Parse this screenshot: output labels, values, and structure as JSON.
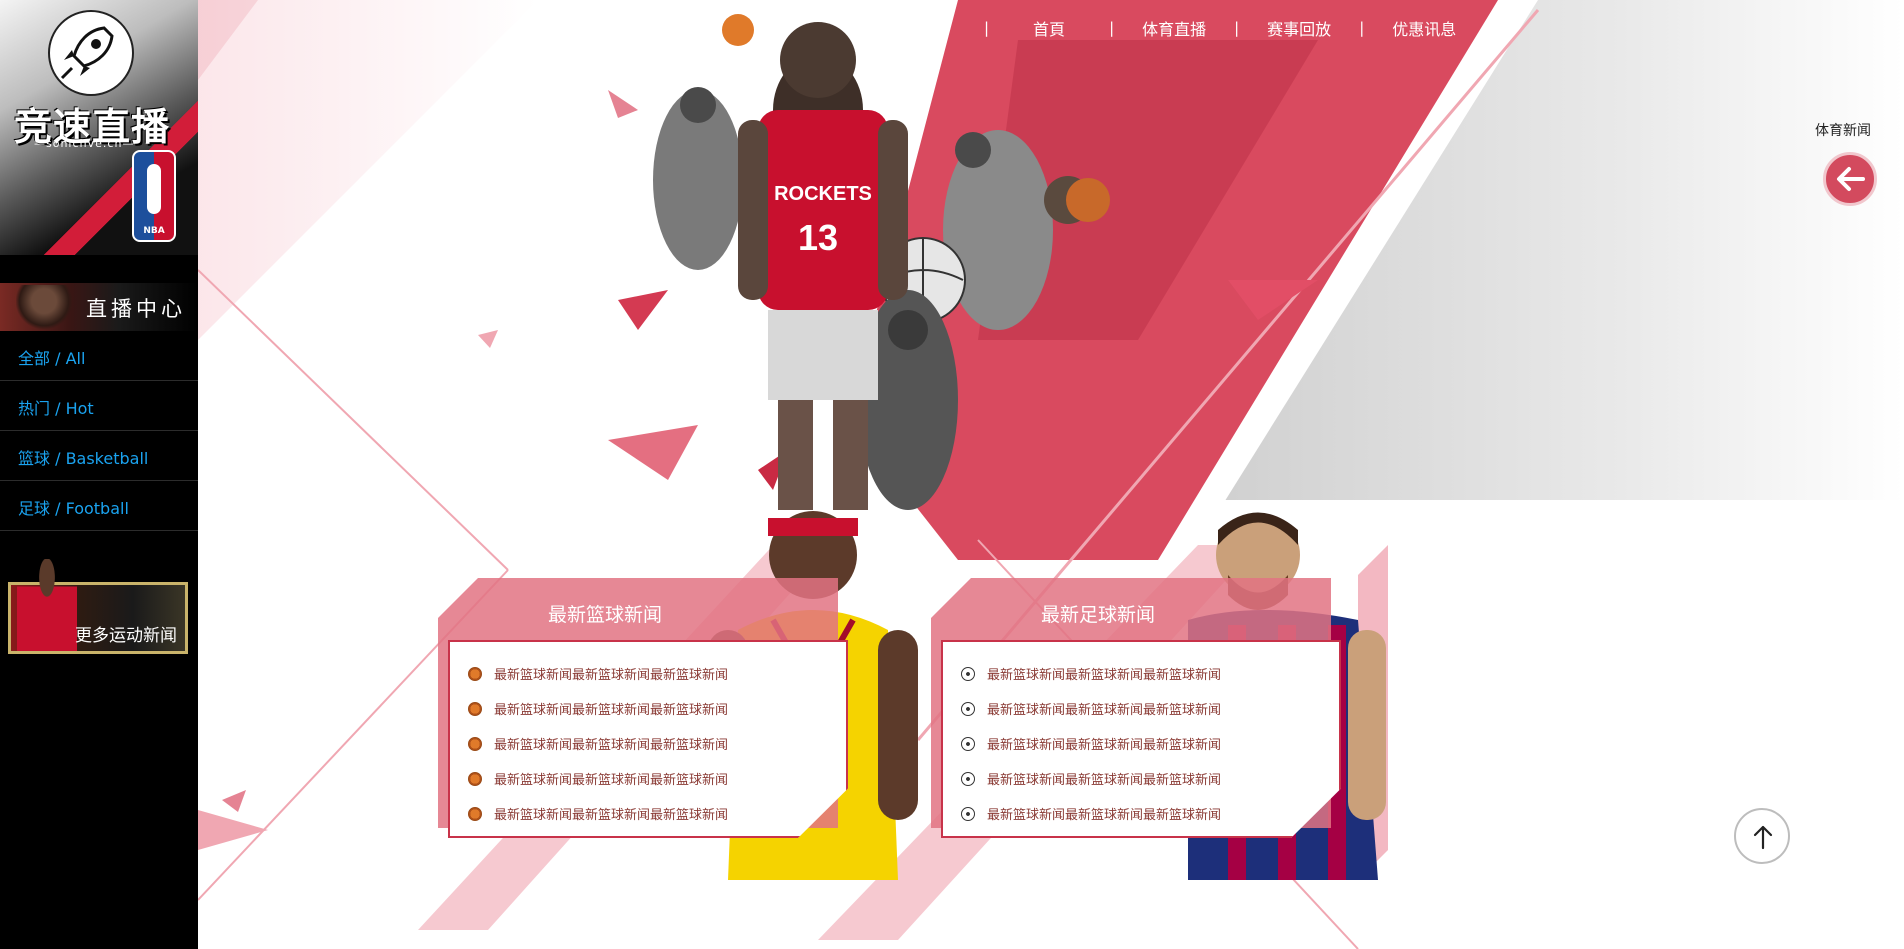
{
  "brand": {
    "name": "竞速直播",
    "domain": "soniclive.cn",
    "league_badge": "NBA"
  },
  "sidebar": {
    "live_center_label": "直播中心",
    "menu": [
      {
        "label": "全部 / All"
      },
      {
        "label": "热门 / Hot"
      },
      {
        "label": "篮球 / Basketball"
      },
      {
        "label": "足球 / Football"
      }
    ],
    "more_news_label": "更多运动新闻"
  },
  "topnav": {
    "items": [
      {
        "label": "首頁"
      },
      {
        "label": "体育直播"
      },
      {
        "label": "赛事回放"
      },
      {
        "label": "优惠讯息"
      }
    ]
  },
  "side_widget": {
    "label": "体育新闻",
    "back_icon": "arrow-left-icon"
  },
  "basketball_news": {
    "title": "最新篮球新闻",
    "icon": "basketball-icon",
    "items": [
      "最新篮球新闻最新篮球新闻最新篮球新闻",
      "最新篮球新闻最新篮球新闻最新篮球新闻",
      "最新篮球新闻最新篮球新闻最新篮球新闻",
      "最新篮球新闻最新篮球新闻最新篮球新闻",
      "最新篮球新闻最新篮球新闻最新篮球新闻"
    ]
  },
  "football_news": {
    "title": "最新足球新闻",
    "icon": "soccer-ball-icon",
    "items": [
      "最新篮球新闻最新篮球新闻最新篮球新闻",
      "最新篮球新闻最新篮球新闻最新篮球新闻",
      "最新篮球新闻最新篮球新闻最新篮球新闻",
      "最新篮球新闻最新篮球新闻最新篮球新闻",
      "最新篮球新闻最新篮球新闻最新篮球新闻"
    ]
  },
  "scroll_top_icon": "arrow-up-icon",
  "colors": {
    "accent_red": "#d7263d",
    "menu_link": "#1aa3f0",
    "sidebar_bg": "#000000"
  }
}
